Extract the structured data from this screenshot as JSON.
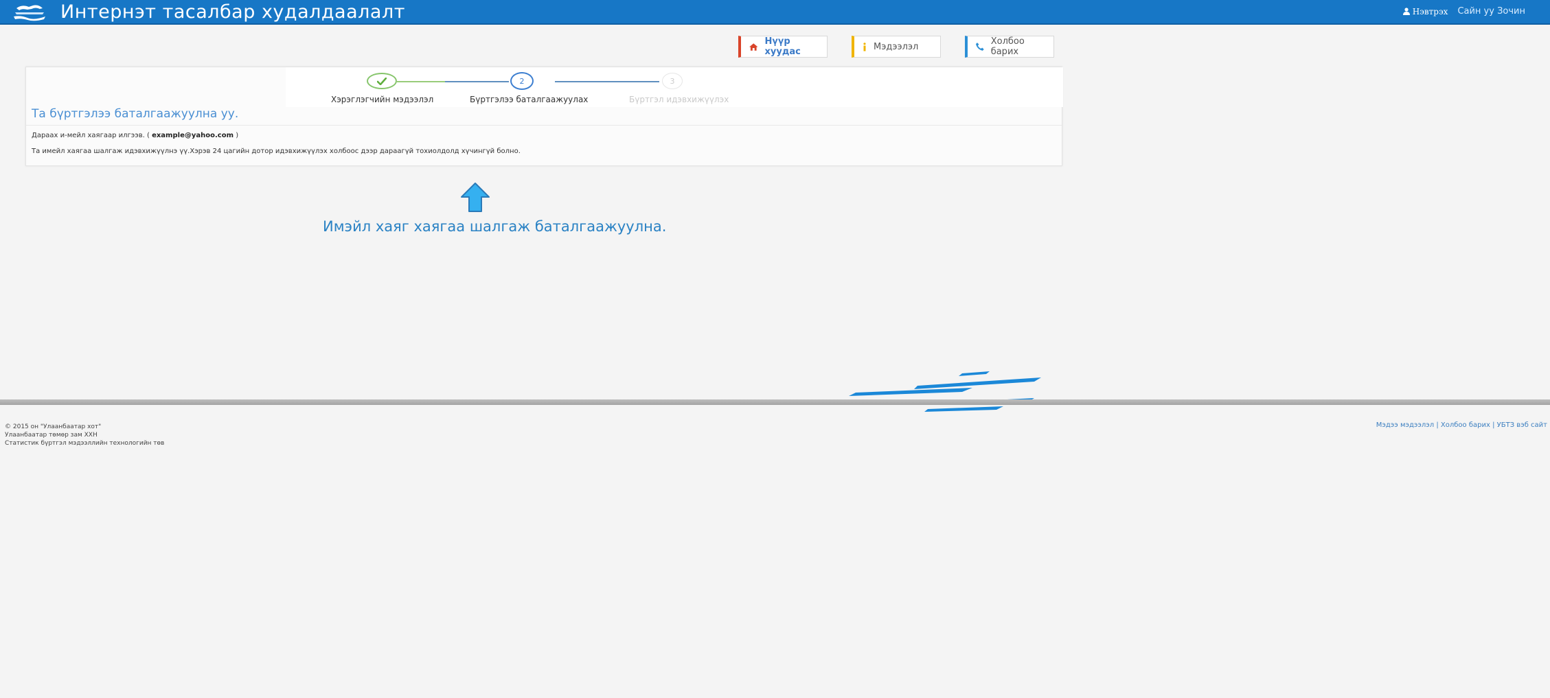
{
  "header": {
    "app_title": "Интернэт тасалбар худалдаалалт",
    "login_label": "Нэвтрэх",
    "greeting": "Сайн уу Зочин"
  },
  "nav": {
    "home": "Нүүр хуудас",
    "info": "Мэдээлэл",
    "contact": "Холбоо барих"
  },
  "steps": [
    {
      "number": "",
      "label": "Хэрэглэгчийн мэдээлэл",
      "state": "done"
    },
    {
      "number": "2",
      "label": "Бүртгэлээ баталгаажуулах",
      "state": "active"
    },
    {
      "number": "3",
      "label": "Бүртгэл идэвхижүүлэх",
      "state": "pending"
    }
  ],
  "panel": {
    "heading": "Та бүртгэлээ баталгаажуулна уу.",
    "email_prefix": "Дараах и-мейл хаягаар илгээв. (",
    "email": "example@yahoo.com",
    "email_suffix": ")",
    "note": "Та имейл хаягаа шалгаж идэвхижүүлнэ үү.Хэрэв 24 цагийн дотор идэвхижүүлэх холбоос дээр дараагүй тохиолдолд хүчингүй болно."
  },
  "annotation": "Имэйл хаяг хаягаа шалгаж баталгаажуулна.",
  "footer": {
    "line1": "© 2015 он \"Улаанбаатар хот\"",
    "line2": "Улаанбаатар төмөр зам ХХН",
    "line3": "Статистик бүртгэл мэдээллийн технологийн төв",
    "links": [
      "Мэдээ мэдээлэл",
      "Холбоо барих",
      "УБТЗ вэб сайт"
    ],
    "separator": " | "
  },
  "colors": {
    "topbar": "#1777c6",
    "accent_blue": "#4a8fd3",
    "home_accent": "#d9442a",
    "info_accent": "#f0b400",
    "contact_accent": "#2b8fd6",
    "step_done": "#86c56b"
  }
}
